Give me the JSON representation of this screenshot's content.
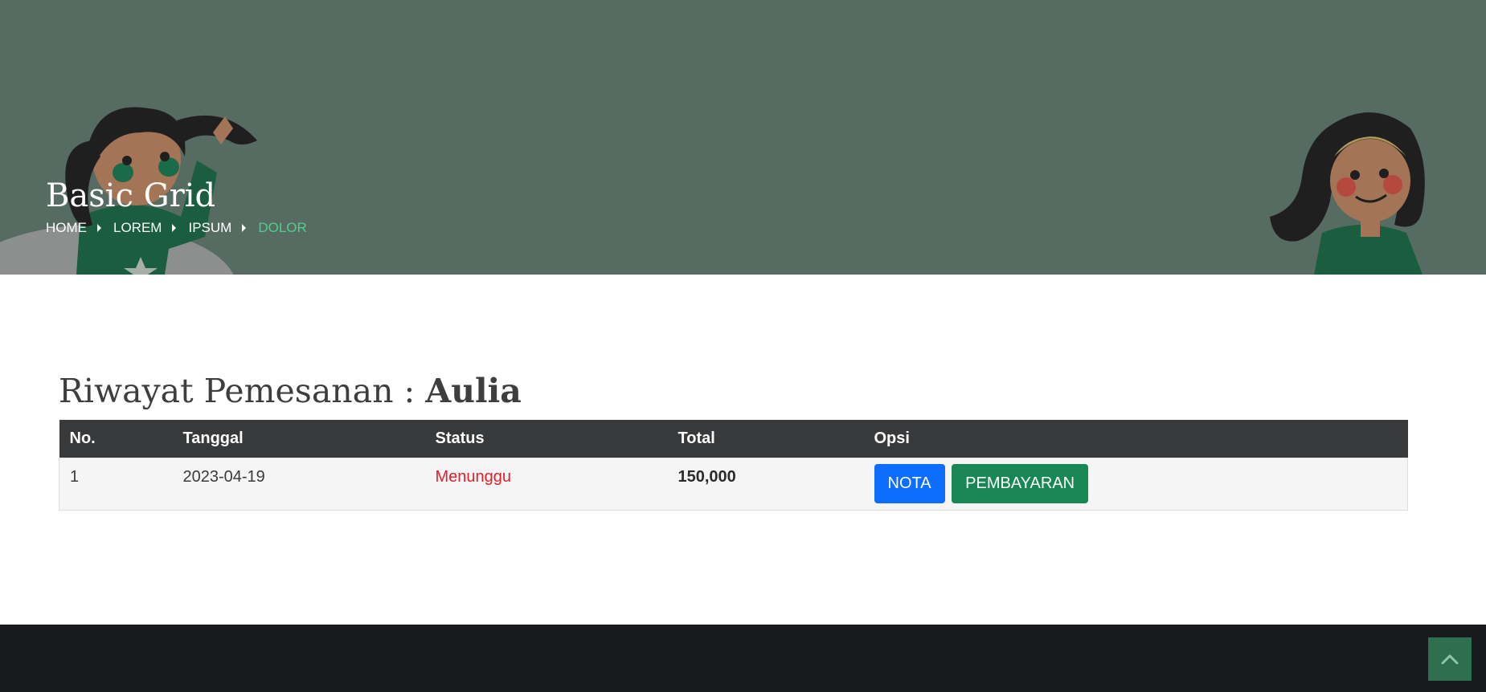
{
  "hero": {
    "title": "Basic Grid",
    "breadcrumb": [
      {
        "label": "HOME"
      },
      {
        "label": "LOREM"
      },
      {
        "label": "IPSUM"
      },
      {
        "label": "DOLOR"
      }
    ]
  },
  "main": {
    "heading_prefix": "Riwayat Pemesanan :",
    "heading_user": "Aulia",
    "table": {
      "headers": [
        "No.",
        "Tanggal",
        "Status",
        "Total",
        "Opsi"
      ],
      "rows": [
        {
          "no": "1",
          "tanggal": "2023-04-19",
          "status": "Menunggu",
          "total": "150,000",
          "nota_label": "NOTA",
          "pembayaran_label": "PEMBAYARAN"
        }
      ]
    }
  },
  "colors": {
    "hero_bg": "#566b62",
    "breadcrumb_active": "#4fd08a",
    "table_header_bg": "#38393b",
    "status_pending": "#e0202b",
    "btn_nota": "#0d6efd",
    "btn_pembayaran": "#198754",
    "footer_bg": "#191a1d",
    "back_to_top_bg": "#2e6f4f"
  },
  "icons": {
    "back_to_top": "chevron-up-icon",
    "breadcrumb_separator": "caret-right-icon"
  }
}
